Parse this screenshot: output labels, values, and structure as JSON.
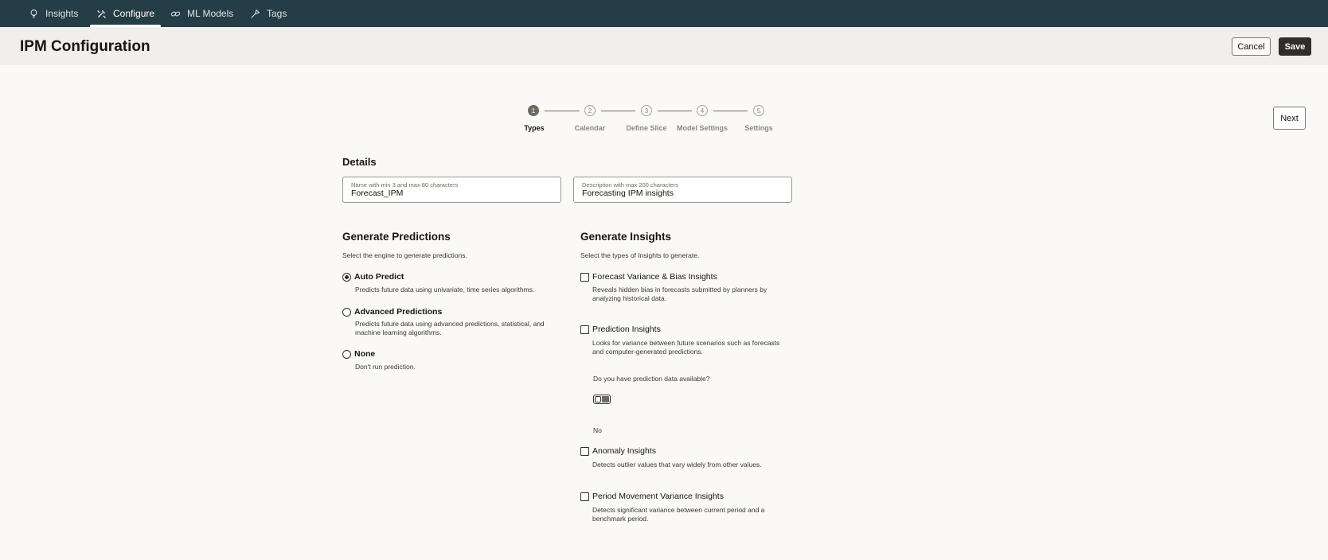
{
  "nav": {
    "tabs": [
      {
        "label": "Insights",
        "icon": "lightbulb-icon",
        "active": false
      },
      {
        "label": "Configure",
        "icon": "tools-icon",
        "active": true
      },
      {
        "label": "ML Models",
        "icon": "link-icon",
        "active": false
      },
      {
        "label": "Tags",
        "icon": "tag-icon",
        "active": false
      }
    ]
  },
  "header": {
    "title": "IPM Configuration",
    "cancel_label": "Cancel",
    "save_label": "Save"
  },
  "stepper": {
    "steps": [
      {
        "number": "1",
        "label": "Types",
        "active": true
      },
      {
        "number": "2",
        "label": "Calendar",
        "active": false
      },
      {
        "number": "3",
        "label": "Define Slice",
        "active": false
      },
      {
        "number": "4",
        "label": "Model Settings",
        "active": false
      },
      {
        "number": "5",
        "label": "Settings",
        "active": false
      }
    ],
    "next_label": "Next"
  },
  "details": {
    "heading": "Details",
    "name_field": {
      "label": "Name with min 3 and max 80 characters",
      "value": "Forecast_IPM"
    },
    "description_field": {
      "label": "Description with max 200 characters",
      "value": "Forecasting IPM insights"
    }
  },
  "predictions": {
    "heading": "Generate Predictions",
    "subtitle": "Select the engine to generate predictions.",
    "options": [
      {
        "title": "Auto Predict",
        "desc": "Predicts future data using univariate, time series algorithms.",
        "checked": true
      },
      {
        "title": "Advanced Predictions",
        "desc": "Predicts future data using advanced predictions, statistical, and machine learning algorithms.",
        "checked": false
      },
      {
        "title": "None",
        "desc": "Don't run prediction.",
        "checked": false
      }
    ]
  },
  "insights": {
    "heading": "Generate Insights",
    "subtitle": "Select the types of Insights to generate.",
    "options": [
      {
        "title": "Forecast Variance & Bias Insights",
        "desc": "Reveals hidden bias in forecasts submitted by planners by analyzing historical data.",
        "checked": false
      },
      {
        "title": "Prediction Insights",
        "desc": "Looks for variance between future scenarios such as forecasts and computer-generated predictions.",
        "checked": false
      },
      {
        "title": "Anomaly Insights",
        "desc": "Detects outlier values that vary widely from other values.",
        "checked": false
      },
      {
        "title": "Period Movement Variance Insights",
        "desc": "Detects significant variance between current period and a benchmark period.",
        "checked": false
      }
    ],
    "prediction_data_question": "Do you have prediction data available?",
    "prediction_data_toggle_value": "No"
  },
  "colors": {
    "nav_bg": "#253d44",
    "header_bg": "#f1efed",
    "page_bg": "#fbf9f8",
    "primary_button": "#312d2a"
  }
}
